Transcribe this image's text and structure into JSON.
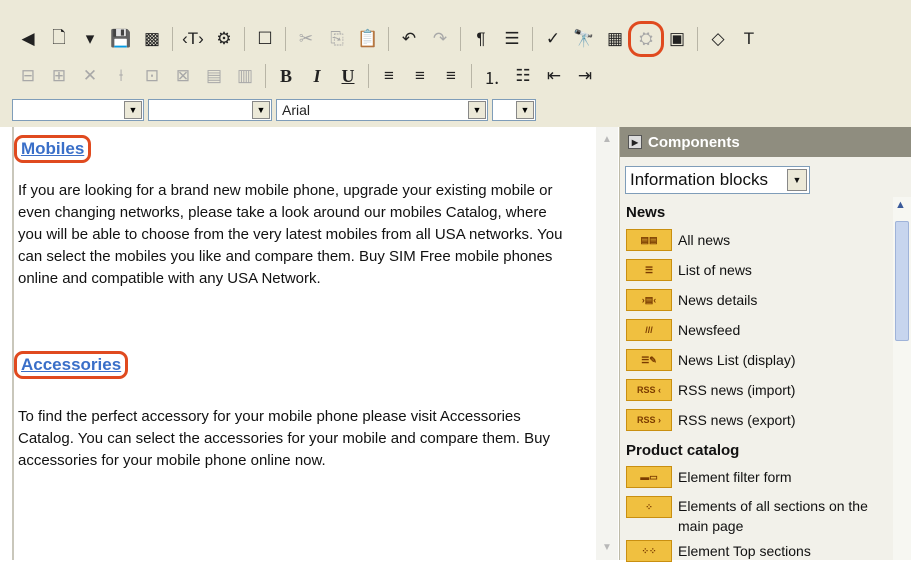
{
  "toolbar": {
    "row1": [
      {
        "name": "component-panel-icon",
        "glyph": "◀",
        "dim": false
      },
      {
        "name": "new-page-icon",
        "glyph": "🗋",
        "dim": false
      },
      {
        "name": "new-page-dropdown-icon",
        "glyph": "▾",
        "dim": false
      },
      {
        "name": "save-icon",
        "glyph": "💾",
        "dim": false
      },
      {
        "name": "save-as-icon",
        "glyph": "▩",
        "dim": false
      },
      {
        "sep": true
      },
      {
        "name": "tag-icon",
        "glyph": "‹T›",
        "dim": false
      },
      {
        "name": "page-properties-icon",
        "glyph": "⚙",
        "dim": false
      },
      {
        "sep": true
      },
      {
        "name": "form-icon",
        "glyph": "☐",
        "dim": false
      },
      {
        "sep": true
      },
      {
        "name": "cut-icon",
        "glyph": "✂",
        "dim": true
      },
      {
        "name": "copy-icon",
        "glyph": "⎘",
        "dim": true
      },
      {
        "name": "paste-icon",
        "glyph": "📋",
        "dim": false
      },
      {
        "sep": true
      },
      {
        "name": "undo-icon",
        "glyph": "↶",
        "dim": false
      },
      {
        "name": "redo-icon",
        "glyph": "↷",
        "dim": true
      },
      {
        "sep": true
      },
      {
        "name": "paragraph-icon",
        "glyph": "¶",
        "dim": false
      },
      {
        "name": "align-block-icon",
        "glyph": "☰",
        "dim": false
      },
      {
        "sep": true
      },
      {
        "name": "spellcheck-icon",
        "glyph": "✓",
        "dim": false
      },
      {
        "name": "find-icon",
        "glyph": "🔭",
        "dim": false
      },
      {
        "name": "table-icon",
        "glyph": "▦",
        "dim": false
      },
      {
        "name": "insert-image-icon",
        "glyph": "⛭",
        "dim": true,
        "highlight": true
      },
      {
        "name": "media-icon",
        "glyph": "▣",
        "dim": false
      },
      {
        "sep": true
      },
      {
        "name": "clear-format-icon",
        "glyph": "◇",
        "dim": false
      },
      {
        "name": "text-color-icon",
        "glyph": "T",
        "dim": false
      }
    ],
    "row2": [
      {
        "name": "insert-row-icon",
        "glyph": "⊟",
        "dim": true
      },
      {
        "name": "insert-col-icon",
        "glyph": "⊞",
        "dim": true
      },
      {
        "name": "delete-row-icon",
        "glyph": "✕",
        "dim": true
      },
      {
        "name": "delete-col-icon",
        "glyph": "⟊",
        "dim": true
      },
      {
        "name": "merge-cells-icon",
        "glyph": "⊡",
        "dim": true
      },
      {
        "name": "split-cells-icon",
        "glyph": "⊠",
        "dim": true
      },
      {
        "name": "cell-props-icon",
        "glyph": "▤",
        "dim": true
      },
      {
        "name": "table-props-icon",
        "glyph": "▥",
        "dim": true
      },
      {
        "sep": true
      },
      {
        "name": "bold-icon",
        "glyph": "B",
        "style": "bold",
        "dim": false
      },
      {
        "name": "italic-icon",
        "glyph": "I",
        "style": "ital",
        "dim": false
      },
      {
        "name": "underline-icon",
        "glyph": "U",
        "style": "und",
        "dim": false
      },
      {
        "sep": true
      },
      {
        "name": "align-left-icon",
        "glyph": "≡",
        "dim": false
      },
      {
        "name": "align-center-icon",
        "glyph": "≡",
        "dim": false
      },
      {
        "name": "align-right-icon",
        "glyph": "≡",
        "dim": false
      },
      {
        "sep": true
      },
      {
        "name": "ordered-list-icon",
        "glyph": "⒈",
        "dim": false
      },
      {
        "name": "unordered-list-icon",
        "glyph": "☷",
        "dim": false
      },
      {
        "name": "outdent-icon",
        "glyph": "⇤",
        "dim": false
      },
      {
        "name": "indent-icon",
        "glyph": "⇥",
        "dim": false
      }
    ]
  },
  "format_bar": {
    "style_value": "",
    "size_value": "",
    "font_value": "Arial",
    "fontsize_value": ""
  },
  "editor": {
    "heading1": "Mobiles",
    "para1": "If you are looking for a brand new mobile phone, upgrade your existing mobile or even changing networks, please take a look around our mobiles Catalog, where you will be able to choose from the very latest mobiles from all USA networks. You can select the mobiles you like and compare them. Buy SIM Free mobile phones online and compatible with any USA Network.",
    "heading2": "Accessories",
    "para2": "To find the perfect accessory for your mobile phone please visit Accessories Catalog. You can select the accessories for your mobile and compare them. Buy accessories for your mobile phone online now."
  },
  "panel": {
    "title": "Components",
    "selector_value": "Information blocks",
    "category_news": "News",
    "news_items": [
      {
        "label": "All news",
        "icon": "▤▤"
      },
      {
        "label": "List of news",
        "icon": "☰"
      },
      {
        "label": "News details",
        "icon": "›▤‹"
      },
      {
        "label": "Newsfeed",
        "icon": "///"
      },
      {
        "label": "News List (display)",
        "icon": "☰✎"
      },
      {
        "label": "RSS news (import)",
        "icon": "RSS ‹"
      },
      {
        "label": "RSS news (export)",
        "icon": "RSS ›"
      }
    ],
    "category_catalog": "Product catalog",
    "catalog_items": [
      {
        "label": "Element filter form",
        "icon": "▬▭"
      },
      {
        "label": "Elements of all sections on the main page",
        "icon": "⁘"
      },
      {
        "label": "Element Top sections",
        "icon": "⁘⁘"
      }
    ]
  }
}
